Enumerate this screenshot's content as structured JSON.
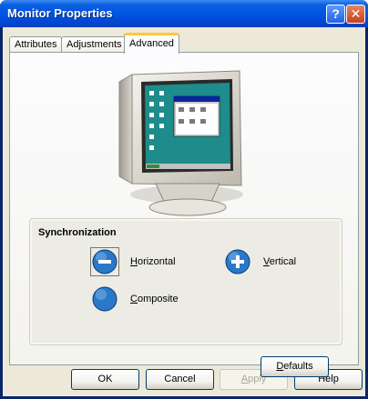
{
  "window": {
    "title": "Monitor Properties",
    "help_glyph": "?",
    "close_glyph": "✕"
  },
  "tabs": [
    {
      "label": "Attributes",
      "active": false
    },
    {
      "label": "Adjustments",
      "active": false
    },
    {
      "label": "Advanced",
      "active": true
    }
  ],
  "sync": {
    "title": "Synchronization",
    "horizontal": {
      "mnemonic": "H",
      "rest": "orizontal",
      "sign": "minus"
    },
    "vertical": {
      "mnemonic": "V",
      "rest": "ertical",
      "sign": "plus"
    },
    "composite": {
      "mnemonic": "C",
      "rest": "omposite",
      "sign": "none"
    }
  },
  "buttons": {
    "defaults": {
      "mnemonic": "D",
      "rest": "efaults"
    },
    "ok": "OK",
    "cancel": "Cancel",
    "apply": {
      "mnemonic": "A",
      "rest": "pply",
      "enabled": false
    },
    "help": "Help"
  },
  "colors": {
    "titlebar": "#0055e5",
    "tab_highlight": "#ffc83c",
    "dialog_bg": "#ece9d8",
    "sync_button": "#2a78c8"
  }
}
